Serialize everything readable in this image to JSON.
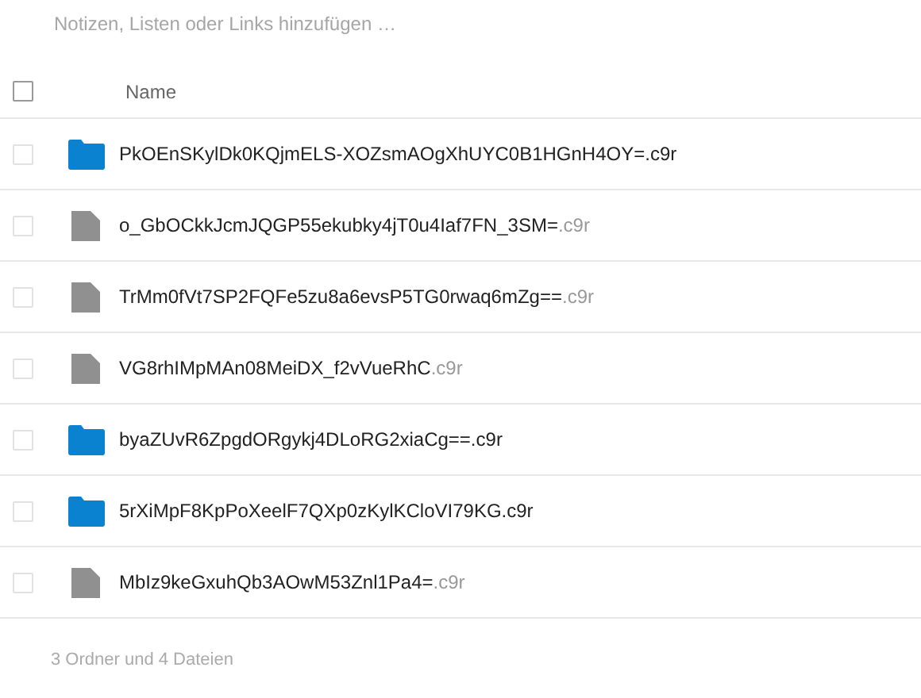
{
  "notes": {
    "placeholder": "Notizen, Listen oder Links hinzufügen …"
  },
  "table": {
    "select_all": {
      "checked": false
    },
    "columns": [
      "Name"
    ],
    "rows": [
      {
        "kind": "folder",
        "name": "PkOEnSKylDk0KQjmELS-XOZsmAOgXhUYC0B1HGnH4OY=.c9r",
        "checked": false
      },
      {
        "kind": "file",
        "name": "o_GbOCkkJcmJQGP55ekubky4jT0u4Iaf7FN_3SM=",
        "extension": ".c9r",
        "checked": false
      },
      {
        "kind": "file",
        "name": "TrMm0fVt7SP2FQFe5zu8a6evsP5TG0rwaq6mZg==",
        "extension": ".c9r",
        "checked": false
      },
      {
        "kind": "file",
        "name": "VG8rhIMpMAn08MeiDX_f2vVueRhC",
        "extension": ".c9r",
        "checked": false
      },
      {
        "kind": "folder",
        "name": "byaZUvR6ZpgdORgykj4DLoRG2xiaCg==.c9r",
        "checked": false
      },
      {
        "kind": "folder",
        "name": "5rXiMpF8KpPoXeelF7QXp0zKylKCloVI79KG.c9r",
        "checked": false
      },
      {
        "kind": "file",
        "name": "MbIz9keGxuhQb3AOwM53Znl1Pa4=",
        "extension": ".c9r",
        "checked": false
      }
    ]
  },
  "summary": "3 Ordner und 4 Dateien"
}
